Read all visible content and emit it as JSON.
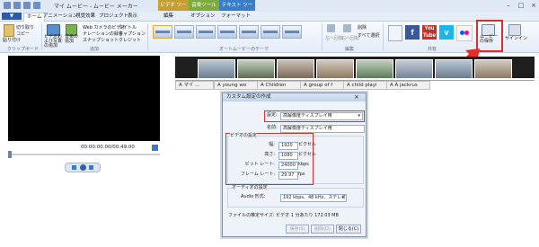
{
  "titlebar": {
    "title": "マイ ムービー - ムービー メーカー",
    "context_tabs": {
      "video": "ビデオ ツール",
      "music": "音楽ツール",
      "text": "テキスト ツール"
    }
  },
  "tabs": {
    "file": "▼",
    "home": "ホーム",
    "animation": "アニメーション",
    "visual_effects": "視覚効果",
    "project": "プロジェクト",
    "view": "表示",
    "edit": "編集",
    "options": "オプション",
    "format": "フォーマット"
  },
  "ribbon": {
    "clipboard": {
      "paste": "貼り付け",
      "cut": "切り取り",
      "copy": "コピー",
      "group": "クリップボード"
    },
    "add": {
      "add_video_photo": "ビデオおよび写真の追加",
      "add_music": "音楽の追加",
      "webcam": "Web カメラのビデオ",
      "narration": "ナレーションの録音",
      "snapshot": "スナップショット",
      "title": "タイトル",
      "caption": "キャプション",
      "credits": "クレジット",
      "group": "追加"
    },
    "themes_group": "オートムービーのテーマ",
    "editing": {
      "rotate_left": "左へ回転",
      "rotate_right": "右へ回転",
      "delete": "削除",
      "select_all": "すべて選択",
      "group": "編集"
    },
    "share": {
      "save_movie": "ムービーの保存",
      "signin": "サインイン",
      "group": "共有"
    }
  },
  "player": {
    "time": "00:00:00.00/00:49.00"
  },
  "storyboard": {
    "captions": [
      "A マイ ...",
      "A young wo",
      "A Children",
      "A group of f",
      "A child playi",
      "A A jackrus"
    ]
  },
  "dialog": {
    "title": "カスタム設定の作成",
    "setting_label": "設定:",
    "setting_value": "高解像度ディスプレイ用",
    "name_label": "名前:",
    "name_value": "高解像度ディスプレイ用",
    "video_section": "ビデオの設定",
    "width_label": "幅:",
    "width_value": "1920",
    "width_unit": "ピクセル",
    "height_label": "高さ:",
    "height_value": "1080",
    "height_unit": "ピクセル",
    "bitrate_label": "ビット レート:",
    "bitrate_value": "24000",
    "bitrate_unit": "kbps",
    "framerate_label": "フレーム レート:",
    "framerate_value": "29.97",
    "framerate_unit": "fps",
    "audio_section": "オーディオの設定",
    "audio_format_label": "Audio 形式:",
    "audio_format_value": "192 kbps、48 kHz、ステレオ",
    "estimate": "ファイルの推定サイズ: ビデオ 1 分あたり 172.03 MB",
    "btn_save": "保存(S)",
    "btn_delete": "削除(D)",
    "btn_close": "閉じる(C)"
  },
  "colors": {
    "accent_red": "#d62f2f",
    "ribbon_blue": "#2a5ba8"
  }
}
